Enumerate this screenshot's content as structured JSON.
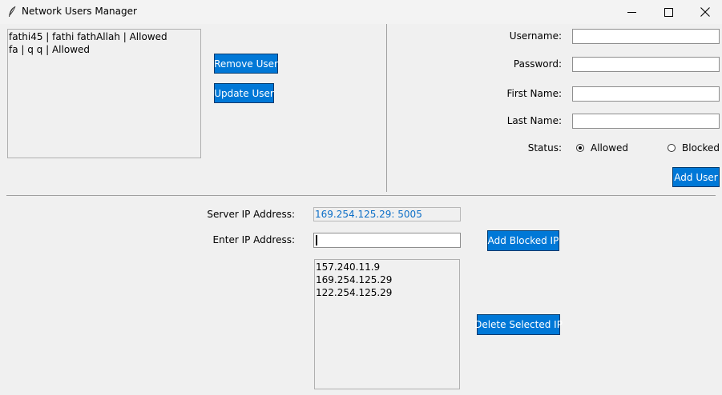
{
  "window": {
    "title": "Network Users Manager"
  },
  "users_list": {
    "items": [
      "fathi45 | fathi fathAllah | Allowed",
      "fa | q q | Allowed"
    ]
  },
  "buttons": {
    "remove_user": "Remove User",
    "update_user": "Update User",
    "add_user": "Add User",
    "add_blocked_ip": "Add Blocked IP",
    "delete_selected_ip": "Delete Selected IP"
  },
  "form": {
    "username_label": "Username:",
    "password_label": "Password:",
    "first_name_label": "First Name:",
    "last_name_label": "Last Name:",
    "status_label": "Status:",
    "status_options": [
      "Allowed",
      "Blocked"
    ],
    "status_selected": "Allowed"
  },
  "server": {
    "label": "Server IP Address:",
    "value": "169.254.125.29: 5005"
  },
  "ip_entry": {
    "label": "Enter IP Address:",
    "value": ""
  },
  "blocked_ips": [
    "157.240.11.9",
    "169.254.125.29",
    "122.254.125.29"
  ],
  "colors": {
    "button": "#0078d7",
    "server_ip_text": "#0b6ec7"
  },
  "icons": {
    "app": "feather-icon",
    "minimize": "minimize-icon",
    "maximize": "maximize-icon",
    "close": "close-icon"
  }
}
